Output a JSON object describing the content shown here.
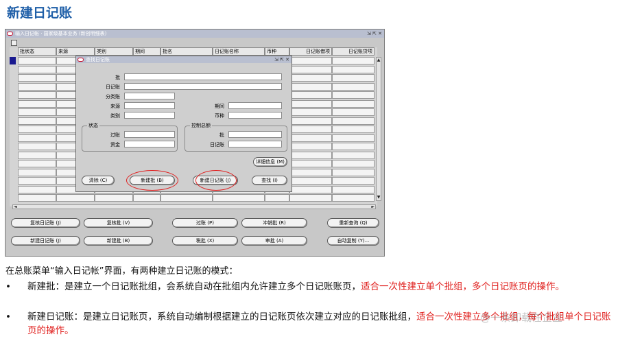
{
  "slide_title": "新建日记账",
  "app": {
    "window_title": "输入日记帐 · 国家级基本业务 (新创明细表)",
    "columns": [
      "批状态",
      "来源",
      "类别",
      "期间",
      "批名",
      "日记账名称",
      "币种",
      "日记账借项",
      "日记账贷项"
    ],
    "buttons": {
      "review_journal": "复核日记账 (J)",
      "review_batch": "复核批 (V)",
      "post": "过账 (P)",
      "reverse_batch": "冲销批 (R)",
      "requery": "重新查询 (Q)",
      "new_journal": "新建日记账 (J)",
      "new_batch": "新建批 (B)",
      "tax_batch": "税批 (X)",
      "approve": "审批 (A)",
      "autocopy": "自动复制 (Y)..."
    }
  },
  "dialog": {
    "title": "查找日记账",
    "labels": {
      "batch": "批",
      "journal": "日记账",
      "category_ledger": "分类账",
      "source": "来源",
      "category": "类别",
      "period": "期间",
      "currency": "币种",
      "status_group": "状态",
      "posting": "过账",
      "funds": "资金",
      "control_group": "控制总额",
      "ctrl_batch": "批",
      "ctrl_journal": "日记账"
    },
    "buttons": {
      "details": "详细信息 (M)",
      "clear": "清除 (C)",
      "new_batch": "新建批 (B)",
      "new_journal": "新建日记账 (J)",
      "find": "查找 (I)"
    }
  },
  "text": {
    "intro": "在总账菜单“输入日记帐”界面，有两种建立日记账的模式：",
    "bullet": "•",
    "b1_normal": "新建批：是建立一个日记账批组，会系统自动在批组内允许建立多个日记账账页，",
    "b1_red": "适合一次性建立单个批组，多个日记账页的操作。",
    "b2_normal": "新建日记账：是建立日记账页，系统自动编制根据建立的日记账页依次建立对应的日记账批组，",
    "b2_red": "适合一次性建立多个批组，每个批组单个日记账页的操作。"
  },
  "watermark": "@一条卸载在企业",
  "colors": {
    "title_blue": "#1f5fa8",
    "highlight_red": "#e0201e"
  }
}
